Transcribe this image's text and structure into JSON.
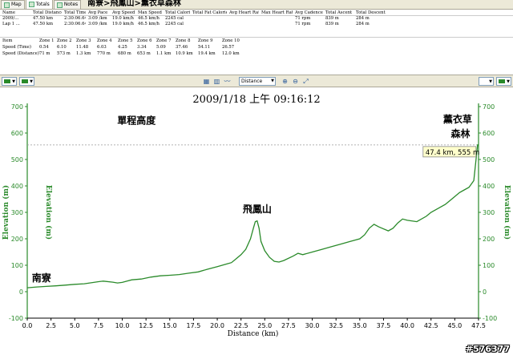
{
  "tabs": [
    {
      "label": "Map"
    },
    {
      "label": "Totals"
    },
    {
      "label": "Notes"
    }
  ],
  "route_title": "南寮>飛鳳山>薰衣草森林",
  "totals": {
    "headers": [
      "Name",
      "Total Distance",
      "Total Time",
      "Avg Pace",
      "Avg Speed",
      "Max Speed",
      "Total Calories",
      "Total Fat Calories",
      "Avg Heart Rate",
      "Max Heart Rate",
      "Avg Cadence",
      "Total Ascent",
      "Total Descent"
    ],
    "rows": [
      [
        "2009/...",
        "47.50 km",
        "2:30:06.64",
        "3:09 /km",
        "19.0 km/h",
        "46.5 km/h",
        "2245 cal",
        "",
        "",
        "",
        "71 rpm",
        "839 m",
        "284 m"
      ],
      [
        "Lap 1 ...",
        "47.50 km",
        "2:30:06.64",
        "3:09 /km",
        "19.0 km/h",
        "46.5 km/h",
        "2245 cal",
        "",
        "",
        "",
        "71 rpm",
        "839 m",
        "284 m"
      ]
    ]
  },
  "zones": {
    "headers": [
      "Item",
      "Zone 1",
      "Zone 2",
      "Zone 3",
      "Zone 4",
      "Zone 5",
      "Zone 6",
      "Zone 7",
      "Zone 8",
      "Zone 9",
      "Zone 10"
    ],
    "rows": [
      [
        "Speed (Time)",
        "0.54",
        "6.10",
        "11.48",
        "6.03",
        "4.25",
        "3.34",
        "5.09",
        "37.46",
        "54.11",
        "26.57"
      ],
      [
        "Speed (Distance)",
        "71 m",
        "573 m",
        "1.3 km",
        "770 m",
        "680 m",
        "653 m",
        "1.1 km",
        "10.9 km",
        "19.4 km",
        "12.0 km"
      ]
    ]
  },
  "toolbar": {
    "x_axis_select": "Distance",
    "colors": {
      "series": "#2a8a2a"
    }
  },
  "watermark": "#576377",
  "chart_data": {
    "type": "line",
    "title": "2009/1/18 上午 09:16:12",
    "xlabel": "Distance (km)",
    "ylabel": "Elevation (m)",
    "xlim": [
      0,
      47.5
    ],
    "ylim": [
      -100,
      700
    ],
    "x_ticks": [
      "0.0",
      "2.5",
      "5.0",
      "7.5",
      "10.0",
      "12.5",
      "15.0",
      "17.5",
      "20.0",
      "22.5",
      "25.0",
      "27.5",
      "30.0",
      "32.5",
      "35.0",
      "37.5",
      "40.0",
      "42.5",
      "45.0",
      "47.5"
    ],
    "y_ticks": [
      "-100",
      "0",
      "100",
      "200",
      "300",
      "400",
      "500",
      "600",
      "700"
    ],
    "grid": false,
    "annotations": [
      {
        "text": "單程高度",
        "x": 11.5,
        "y": 635
      },
      {
        "text": "飛鳳山",
        "x": 24.2,
        "y": 300
      },
      {
        "text": "南寮",
        "x": 1.5,
        "y": 40
      },
      {
        "text": "薰衣草",
        "x": 45.3,
        "y": 640
      },
      {
        "text": "森林",
        "x": 45.6,
        "y": 585
      }
    ],
    "tooltip": {
      "text": "47.4 km, 555 m",
      "x": 47.4,
      "y": 555
    },
    "series": [
      {
        "x": [
          0,
          1,
          2,
          3,
          4,
          5,
          6,
          7,
          7.5,
          8,
          9,
          9.5,
          10,
          10.5,
          11,
          12,
          13,
          14,
          15,
          16,
          17,
          18,
          19,
          20,
          21,
          21.5,
          22,
          22.5,
          23,
          23.5,
          23.8,
          24.0,
          24.2,
          24.4,
          24.6,
          25,
          25.5,
          26,
          26.5,
          27,
          28,
          28.5,
          29,
          30,
          31,
          32,
          33,
          34,
          35,
          35.5,
          36,
          36.5,
          37,
          38,
          38.5,
          39,
          39.5,
          40,
          41,
          42,
          42.5,
          43,
          44,
          44.5,
          45,
          45.5,
          46,
          46.5,
          47,
          47.4,
          47.5
        ],
        "y": [
          15,
          18,
          20,
          22,
          25,
          28,
          30,
          35,
          38,
          40,
          36,
          33,
          35,
          40,
          45,
          48,
          55,
          60,
          62,
          65,
          70,
          75,
          85,
          95,
          105,
          110,
          125,
          140,
          160,
          200,
          240,
          265,
          268,
          240,
          190,
          155,
          130,
          115,
          112,
          118,
          135,
          145,
          140,
          150,
          160,
          170,
          180,
          190,
          200,
          215,
          240,
          255,
          245,
          230,
          240,
          260,
          275,
          270,
          265,
          285,
          300,
          310,
          330,
          345,
          360,
          375,
          385,
          395,
          420,
          555,
          555
        ]
      }
    ]
  }
}
